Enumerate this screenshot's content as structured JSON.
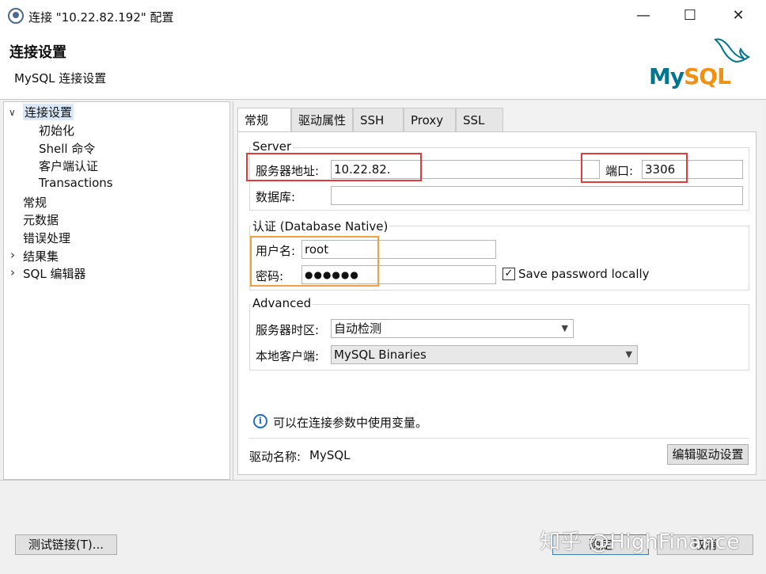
{
  "window": {
    "title": "连接 \"10.22.82.192\" 配置",
    "minimize": "—",
    "maximize": "☐",
    "close": "✕"
  },
  "header": {
    "title": "连接设置",
    "subtitle": "MySQL 连接设置",
    "logo_my": "My",
    "logo_sql": "SQL"
  },
  "tree": {
    "items": [
      {
        "label": "连接设置",
        "twisty": "∨",
        "selected": true
      },
      {
        "label": "初始化"
      },
      {
        "label": "Shell 命令"
      },
      {
        "label": "客户端认证"
      },
      {
        "label": "Transactions"
      },
      {
        "label": "常规"
      },
      {
        "label": "元数据"
      },
      {
        "label": "错误处理"
      },
      {
        "label": "结果集",
        "twisty": "›"
      },
      {
        "label": "SQL 编辑器",
        "twisty": "›"
      }
    ]
  },
  "tabs": [
    {
      "label": "常规",
      "active": true
    },
    {
      "label": "驱动属性"
    },
    {
      "label": "SSH"
    },
    {
      "label": "Proxy"
    },
    {
      "label": "SSL"
    }
  ],
  "server": {
    "group_label": "Server",
    "host_label": "服务器地址:",
    "host_value": "10.22.82.",
    "port_label": "端口:",
    "port_value": "3306",
    "db_label": "数据库:",
    "db_value": ""
  },
  "auth": {
    "group_label": "认证 (Database Native)",
    "user_label": "用户名:",
    "user_value": "root",
    "password_label": "密码:",
    "password_value": "●●●●●●",
    "save_password_label": "Save password locally",
    "save_password_checked": "✓"
  },
  "advanced": {
    "group_label": "Advanced",
    "timezone_label": "服务器时区:",
    "timezone_value": "自动检测",
    "client_label": "本地客户端:",
    "client_value": "MySQL Binaries"
  },
  "info": {
    "icon": "i",
    "text": "可以在连接参数中使用变量。"
  },
  "driver": {
    "label": "驱动名称:",
    "value": "MySQL",
    "edit_button": "编辑驱动设置"
  },
  "footer": {
    "test_button": "测试链接(T)...",
    "ok_button": "确定",
    "cancel_button": "取消",
    "watermark": "知乎 @HighFinance"
  },
  "colors": {
    "highlight_red": "#e03c3c",
    "highlight_orange": "#f0a040",
    "selection": "#d9e7f7",
    "mysql_blue": "#00758f",
    "mysql_orange": "#f29111"
  }
}
